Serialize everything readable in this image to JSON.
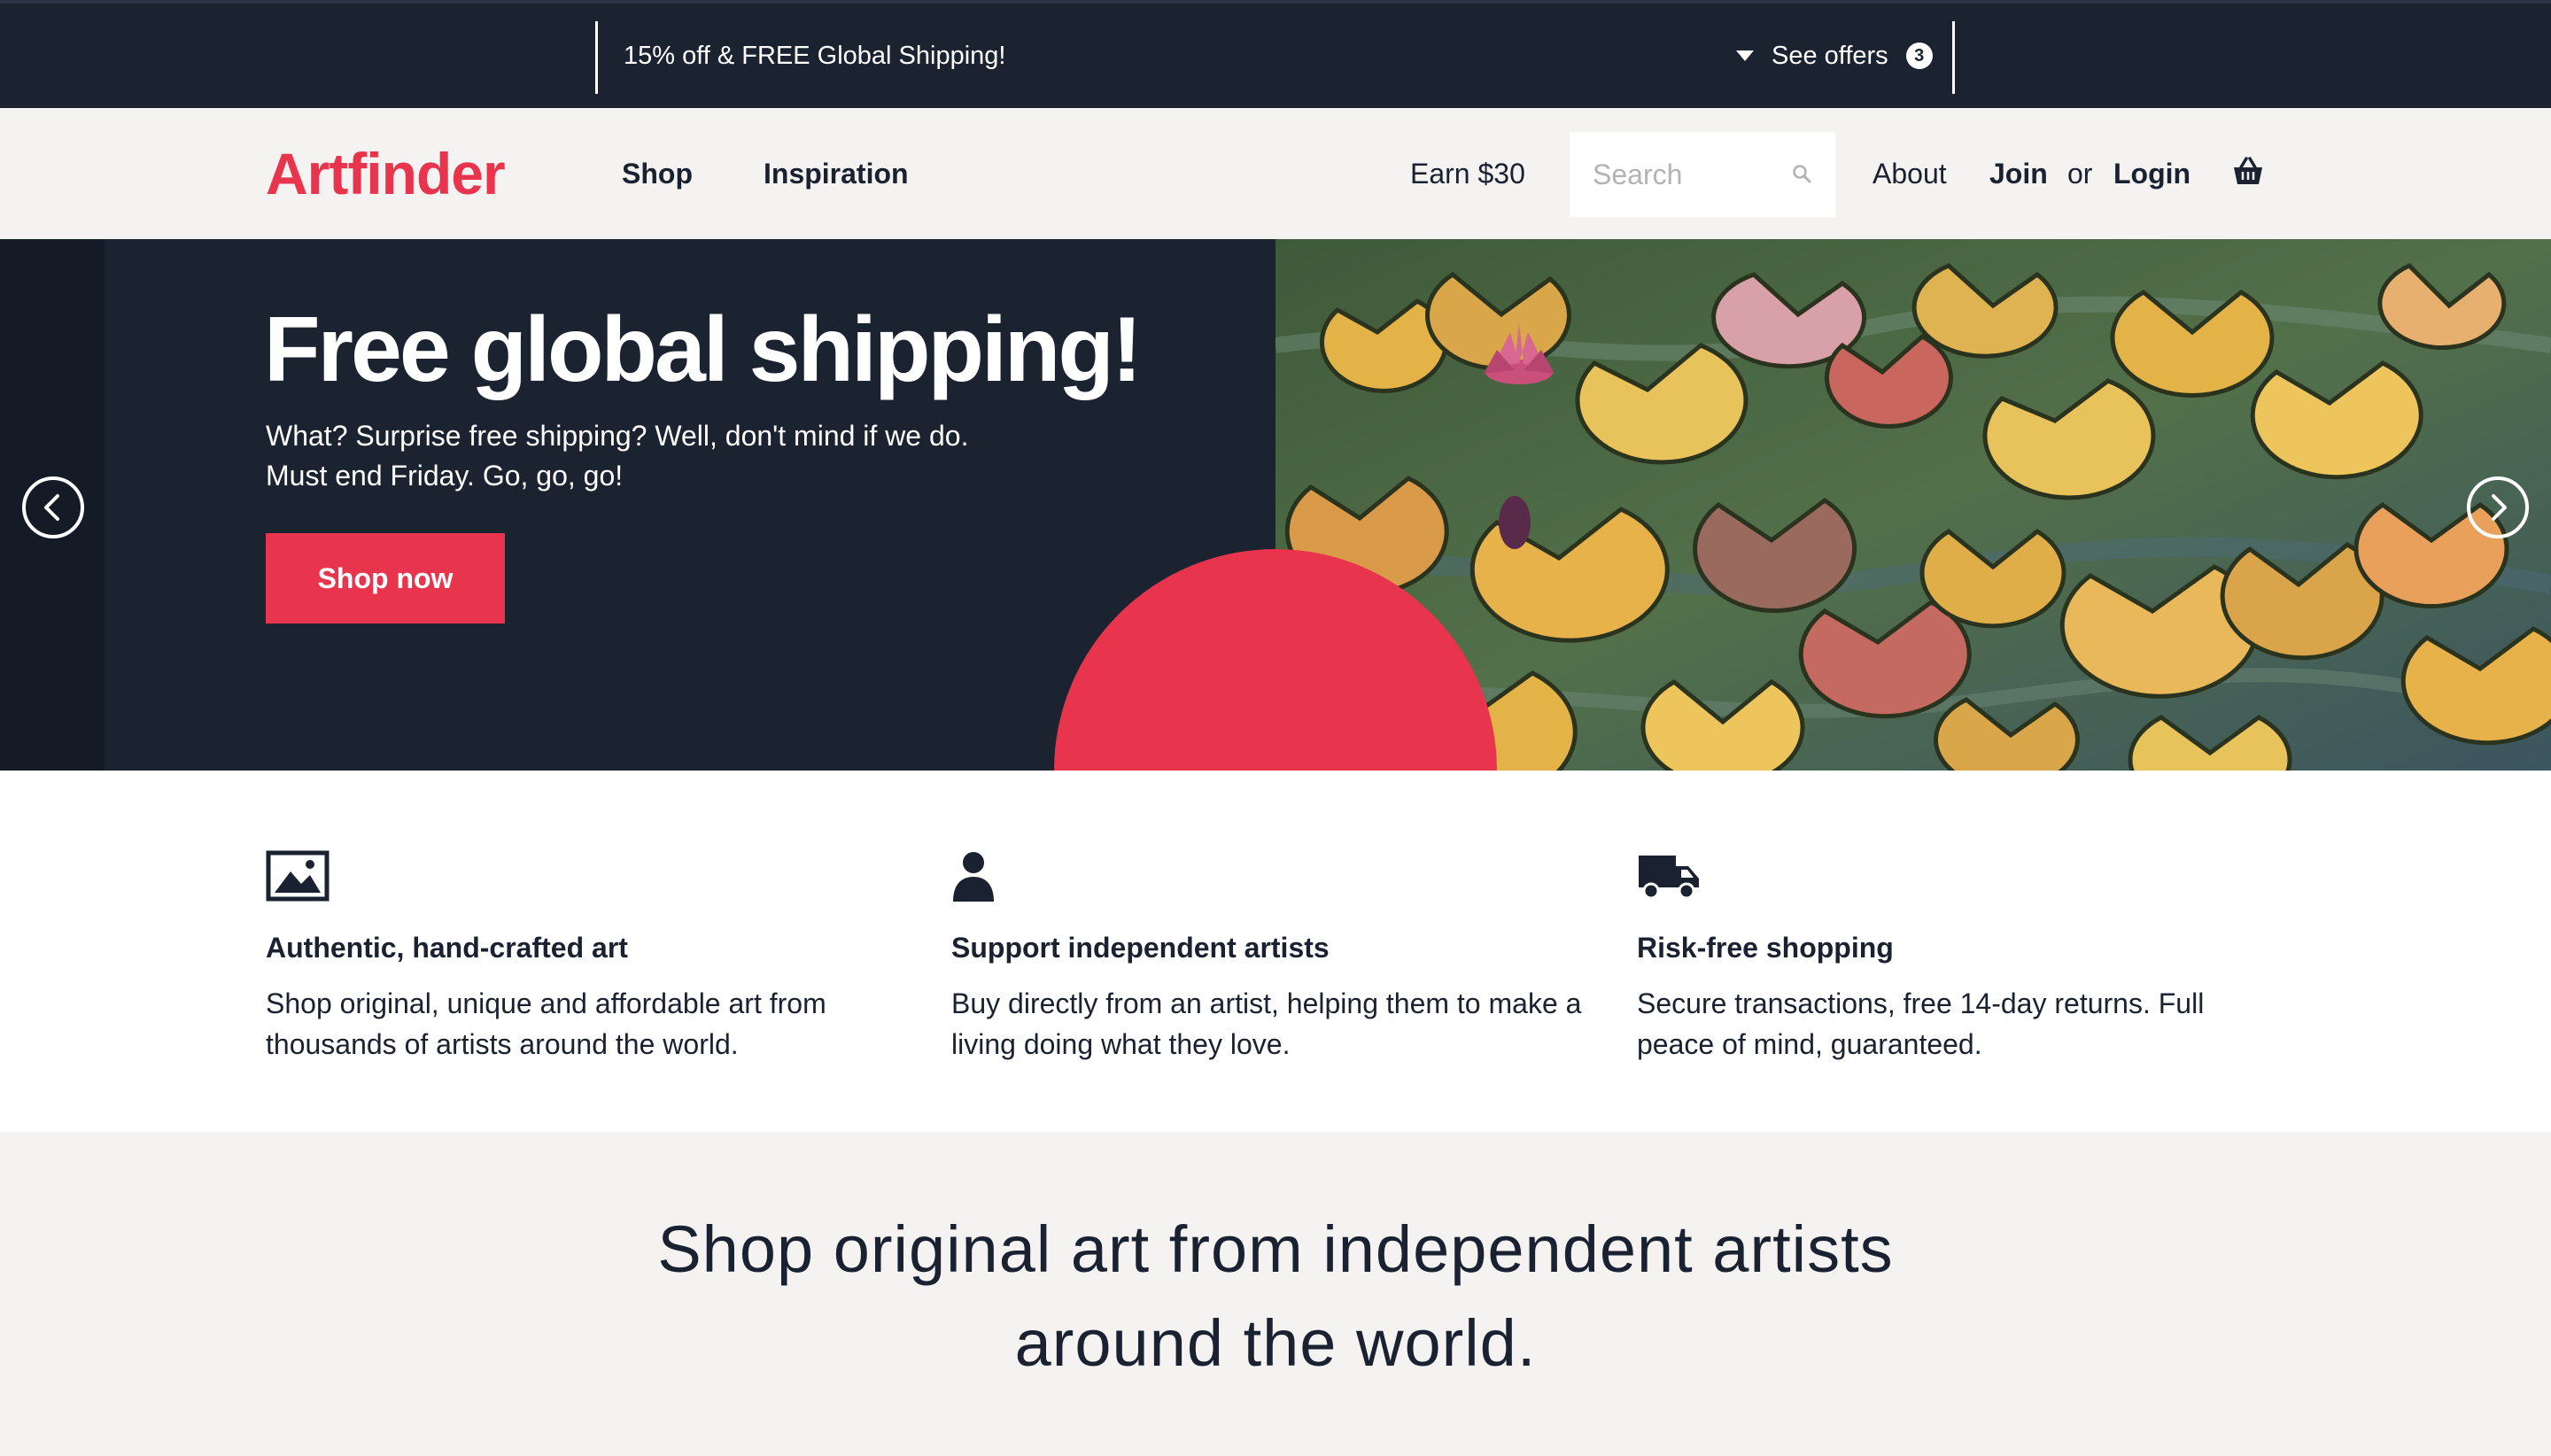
{
  "promo": {
    "message": "15% off & FREE Global Shipping!",
    "offers_label": "See offers",
    "offers_count": "3"
  },
  "header": {
    "logo": "Artfinder",
    "nav": [
      "Shop",
      "Inspiration"
    ],
    "earn": "Earn $30",
    "search_placeholder": "Search",
    "about": "About",
    "join": "Join",
    "or": "or",
    "login": "Login"
  },
  "hero": {
    "title": "Free global shipping!",
    "subtitle": "What? Surprise free shipping? Well, don't mind if we do. Must end Friday. Go, go, go!",
    "cta": "Shop now"
  },
  "features": [
    {
      "icon": "image-icon",
      "title": "Authentic, hand-crafted art",
      "text": "Shop original, unique and affordable art from thousands of artists around the world."
    },
    {
      "icon": "person-icon",
      "title": "Support independent artists",
      "text": "Buy directly from an artist, helping them to make a living doing what they love."
    },
    {
      "icon": "truck-icon",
      "title": "Risk-free shopping",
      "text": "Secure transactions, free 14-day returns. Full peace of mind, guaranteed."
    }
  ],
  "tagline": "Shop original art from independent artists around the world.",
  "colors": {
    "brand": "#e8354d",
    "navy": "#1b2331",
    "page_bg": "#f4f3f1"
  }
}
